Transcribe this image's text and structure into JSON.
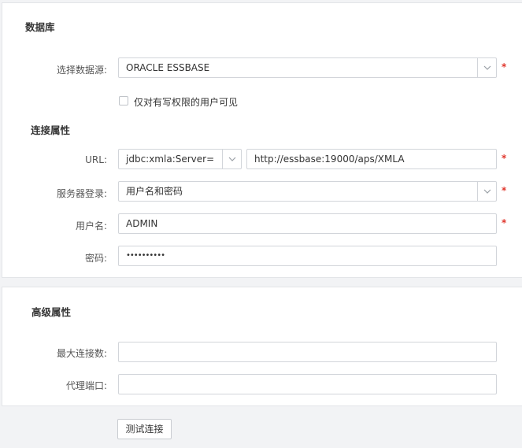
{
  "database_section": {
    "title": "数据库",
    "datasource_label": "选择数据源:",
    "datasource_value": "ORACLE ESSBASE",
    "write_perm_label": "仅对有写权限的用户可见"
  },
  "connection_section": {
    "title": "连接属性",
    "url_label": "URL:",
    "url_prefix": "jdbc:xmla:Server=",
    "url_value": "http://essbase:19000/aps/XMLA",
    "server_login_label": "服务器登录:",
    "server_login_value": "用户名和密码",
    "username_label": "用户名:",
    "username_value": "ADMIN",
    "password_label": "密码:",
    "password_value": "••••••••••"
  },
  "advanced_section": {
    "title": "高级属性",
    "max_conn_label": "最大连接数:",
    "max_conn_value": "",
    "proxy_port_label": "代理端口:",
    "proxy_port_value": ""
  },
  "required_mark": "*",
  "test_button_label": "测试连接",
  "icons": {
    "select_arrow": "chevron-down-icon"
  },
  "colors": {
    "required": "#e0352b",
    "border": "#d2d5da",
    "background": "#f2f3f5"
  }
}
